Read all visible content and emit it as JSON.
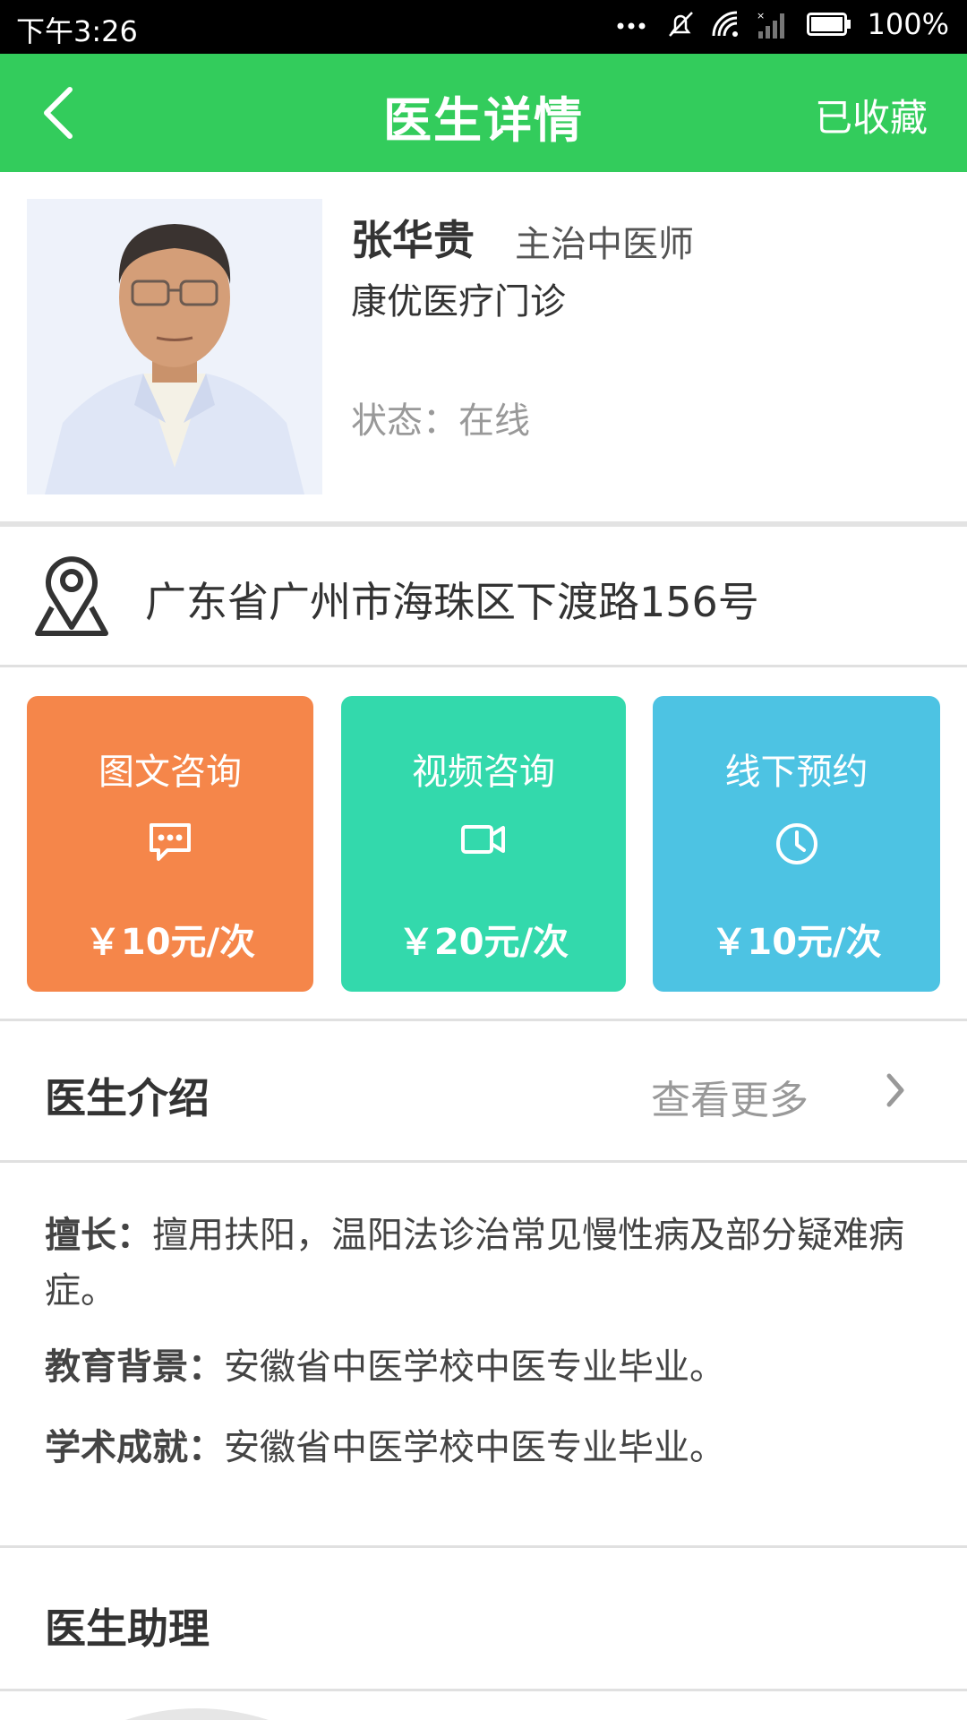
{
  "status_bar": {
    "time": "下午3:26",
    "battery": "100%",
    "icons": [
      "more-dots-icon",
      "mute-icon",
      "wifi-icon",
      "signal-icon",
      "battery-icon"
    ]
  },
  "header": {
    "title": "医生详情",
    "favorite_label": "已收藏",
    "color": "#33cc5c"
  },
  "doctor": {
    "name": "张华贵",
    "title": "主治中医师",
    "clinic": "康优医疗门诊",
    "status": "状态：在线"
  },
  "address": "广东省广州市海珠区下渡路156号",
  "services": [
    {
      "label": "图文咨询",
      "price": "￥10元/次",
      "icon": "chat-icon",
      "color": "#f5864a"
    },
    {
      "label": "视频咨询",
      "price": "￥20元/次",
      "icon": "video-icon",
      "color": "#33d9ac"
    },
    {
      "label": "线下预约",
      "price": "￥10元/次",
      "icon": "clock-icon",
      "color": "#4dc3e3"
    }
  ],
  "intro": {
    "heading": "医生介绍",
    "more_label": "查看更多",
    "specialty_label": "擅长：",
    "specialty_text": "擅用扶阳，温阳法诊治常见慢性病及部分疑难病症。",
    "education_label": "教育背景：",
    "education_text": "安徽省中医学校中医专业毕业。",
    "achievement_label": "学术成就：",
    "achievement_text": "安徽省中医学校中医专业毕业。"
  },
  "assistant": {
    "heading": "医生助理"
  }
}
